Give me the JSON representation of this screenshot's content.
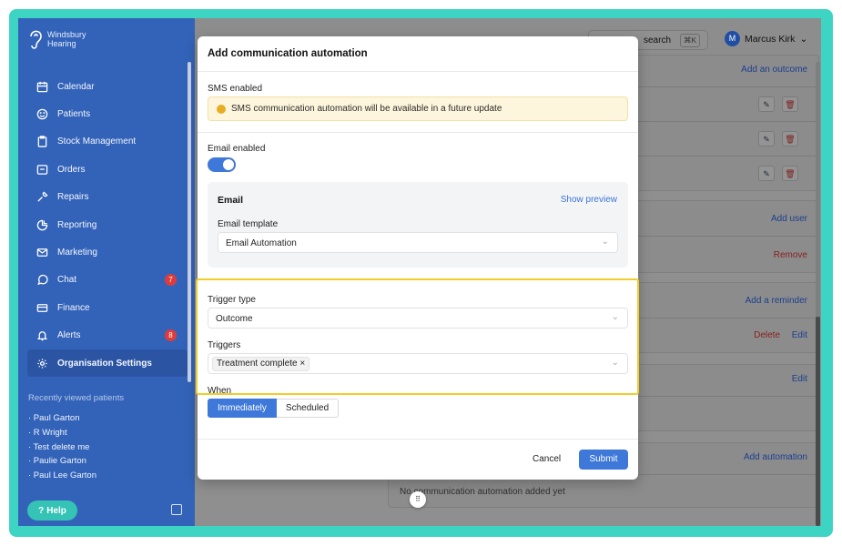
{
  "brand": {
    "line1": "Windsbury",
    "line2": "Hearing"
  },
  "nav": [
    {
      "label": "Calendar",
      "icon": "calendar-icon"
    },
    {
      "label": "Patients",
      "icon": "smile-icon"
    },
    {
      "label": "Stock Management",
      "icon": "clipboard-icon"
    },
    {
      "label": "Orders",
      "icon": "inbox-icon"
    },
    {
      "label": "Repairs",
      "icon": "wrench-icon"
    },
    {
      "label": "Reporting",
      "icon": "pie-chart-icon"
    },
    {
      "label": "Marketing",
      "icon": "mail-icon"
    },
    {
      "label": "Chat",
      "icon": "chat-icon",
      "badge": "7"
    },
    {
      "label": "Finance",
      "icon": "credit-card-icon"
    },
    {
      "label": "Alerts",
      "icon": "bell-icon",
      "badge": "8"
    },
    {
      "label": "Organisation Settings",
      "icon": "gear-icon"
    }
  ],
  "recent": {
    "title": "Recently viewed patients",
    "items": [
      "· Paul Garton",
      "· R Wright",
      "· Test delete me",
      "· Paulie Garton",
      "· Paul Lee Garton"
    ]
  },
  "help_label": "Help",
  "topbar": {
    "search_text": "search",
    "shortcut": "⌘K",
    "user_initial": "M",
    "user_name": "Marcus Kirk"
  },
  "background": {
    "add_outcome": "Add an outcome",
    "add_user": "Add user",
    "remove": "Remove",
    "add_reminder": "Add a reminder",
    "delete": "Delete",
    "edit": "Edit",
    "edit2": "Edit",
    "add_automation": "Add automation",
    "empty_automation": "No communication automation added yet"
  },
  "modal": {
    "title": "Add communication automation",
    "sms_label": "SMS enabled",
    "sms_notice": "SMS communication automation will be available in a future update",
    "email_label": "Email enabled",
    "email_enabled": true,
    "email_heading": "Email",
    "show_preview": "Show preview",
    "template_label": "Email template",
    "template_value": "Email Automation",
    "trigger_type_label": "Trigger type",
    "trigger_type_value": "Outcome",
    "triggers_label": "Triggers",
    "trigger_tag": "Treatment complete",
    "when_label": "When",
    "when_options": [
      "Immediately",
      "Scheduled"
    ],
    "when_selected": "Immediately",
    "cancel": "Cancel",
    "submit": "Submit"
  },
  "colors": {
    "sidebar": "#3363b8",
    "accent": "#3e78d8",
    "frame": "#3dd4c4",
    "highlight": "#f0cd2a",
    "badge": "#e03b3b"
  }
}
